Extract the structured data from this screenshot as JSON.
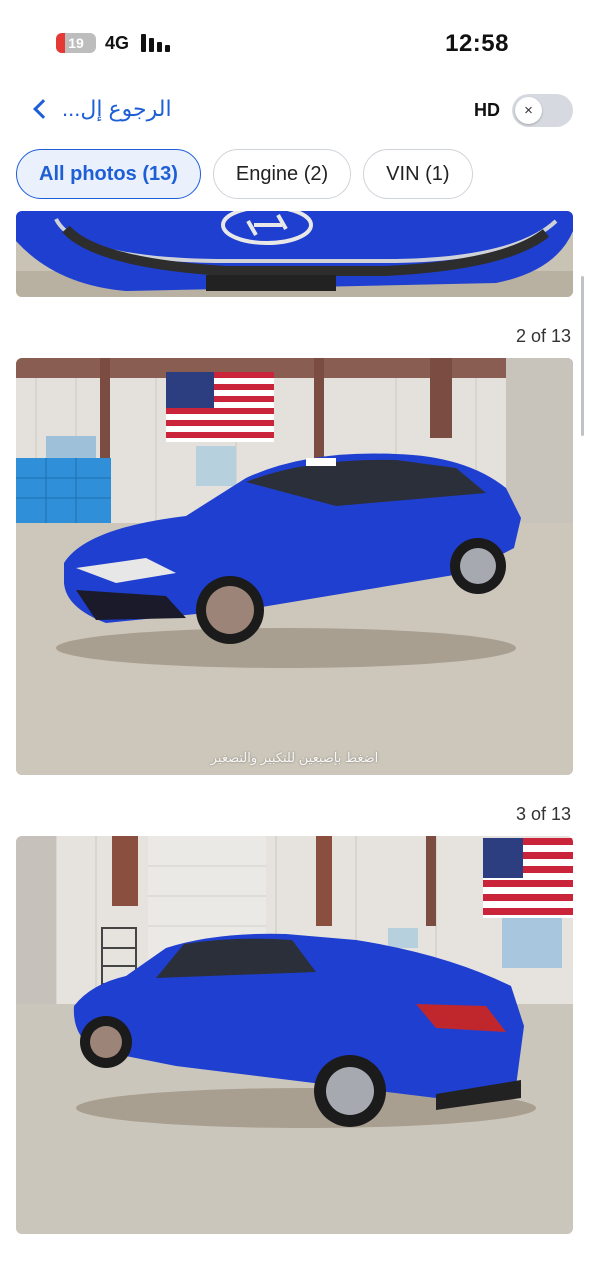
{
  "status_bar": {
    "battery_level": "19",
    "network": "4G",
    "time": "12:58"
  },
  "nav": {
    "back_label": "الرجوع إل...",
    "hd_label": "HD",
    "toggle_icon": "×"
  },
  "chips": [
    {
      "label": "All photos (13)",
      "active": true
    },
    {
      "label": "Engine (2)",
      "active": false
    },
    {
      "label": "VIN (1)",
      "active": false
    }
  ],
  "photos": [
    {
      "caption": "2 of 13",
      "overlay": "اضغط بإصبعين للتكبير والتصغير"
    },
    {
      "caption": "3 of 13"
    }
  ],
  "colors": {
    "accent": "#1e5fd6",
    "car_blue": "#1f3fd1"
  }
}
